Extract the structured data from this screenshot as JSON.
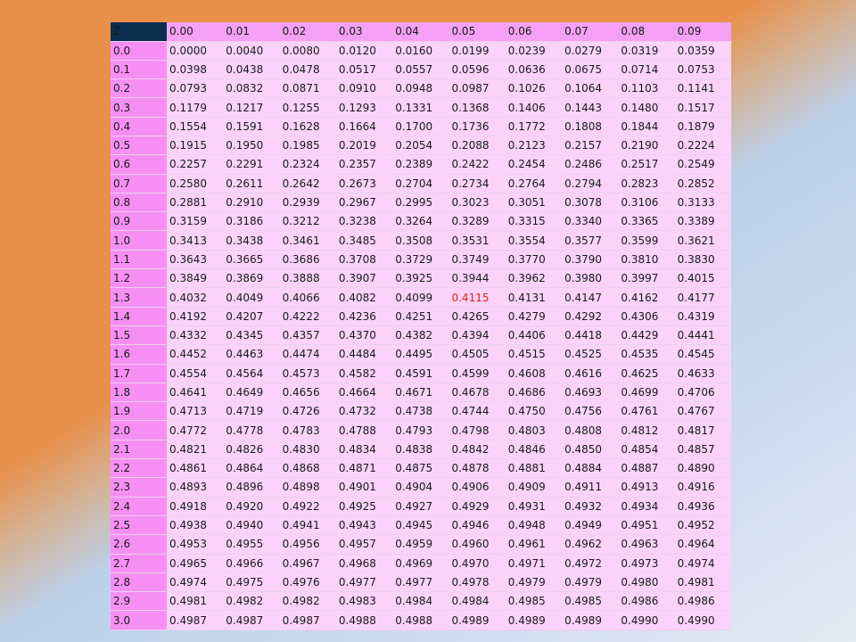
{
  "table": {
    "corner": "Z",
    "highlight_color": "#e8201a",
    "highlight": {
      "row": 13,
      "col": 5
    },
    "columns": [
      "0.00",
      "0.01",
      "0.02",
      "0.03",
      "0.04",
      "0.05",
      "0.06",
      "0.07",
      "0.08",
      "0.09"
    ],
    "rows": [
      {
        "z": "0.0",
        "values": [
          "0.0000",
          "0.0040",
          "0.0080",
          "0.0120",
          "0.0160",
          "0.0199",
          "0.0239",
          "0.0279",
          "0.0319",
          "0.0359"
        ]
      },
      {
        "z": "0.1",
        "values": [
          "0.0398",
          "0.0438",
          "0.0478",
          "0.0517",
          "0.0557",
          "0.0596",
          "0.0636",
          "0.0675",
          "0.0714",
          "0.0753"
        ]
      },
      {
        "z": "0.2",
        "values": [
          "0.0793",
          "0.0832",
          "0.0871",
          "0.0910",
          "0.0948",
          "0.0987",
          "0.1026",
          "0.1064",
          "0.1103",
          "0.1141"
        ]
      },
      {
        "z": "0.3",
        "values": [
          "0.1179",
          "0.1217",
          "0.1255",
          "0.1293",
          "0.1331",
          "0.1368",
          "0.1406",
          "0.1443",
          "0.1480",
          "0.1517"
        ]
      },
      {
        "z": "0.4",
        "values": [
          "0.1554",
          "0.1591",
          "0.1628",
          "0.1664",
          "0.1700",
          "0.1736",
          "0.1772",
          "0.1808",
          "0.1844",
          "0.1879"
        ]
      },
      {
        "z": "0.5",
        "values": [
          "0.1915",
          "0.1950",
          "0.1985",
          "0.2019",
          "0.2054",
          "0.2088",
          "0.2123",
          "0.2157",
          "0.2190",
          "0.2224"
        ]
      },
      {
        "z": "0.6",
        "values": [
          "0.2257",
          "0.2291",
          "0.2324",
          "0.2357",
          "0.2389",
          "0.2422",
          "0.2454",
          "0.2486",
          "0.2517",
          "0.2549"
        ]
      },
      {
        "z": "0.7",
        "values": [
          "0.2580",
          "0.2611",
          "0.2642",
          "0.2673",
          "0.2704",
          "0.2734",
          "0.2764",
          "0.2794",
          "0.2823",
          "0.2852"
        ]
      },
      {
        "z": "0.8",
        "values": [
          "0.2881",
          "0.2910",
          "0.2939",
          "0.2967",
          "0.2995",
          "0.3023",
          "0.3051",
          "0.3078",
          "0.3106",
          "0.3133"
        ]
      },
      {
        "z": "0.9",
        "values": [
          "0.3159",
          "0.3186",
          "0.3212",
          "0.3238",
          "0.3264",
          "0.3289",
          "0.3315",
          "0.3340",
          "0.3365",
          "0.3389"
        ]
      },
      {
        "z": "1.0",
        "values": [
          "0.3413",
          "0.3438",
          "0.3461",
          "0.3485",
          "0.3508",
          "0.3531",
          "0.3554",
          "0.3577",
          "0.3599",
          "0.3621"
        ]
      },
      {
        "z": "1.1",
        "values": [
          "0.3643",
          "0.3665",
          "0.3686",
          "0.3708",
          "0.3729",
          "0.3749",
          "0.3770",
          "0.3790",
          "0.3810",
          "0.3830"
        ]
      },
      {
        "z": "1.2",
        "values": [
          "0.3849",
          "0.3869",
          "0.3888",
          "0.3907",
          "0.3925",
          "0.3944",
          "0.3962",
          "0.3980",
          "0.3997",
          "0.4015"
        ]
      },
      {
        "z": "1.3",
        "values": [
          "0.4032",
          "0.4049",
          "0.4066",
          "0.4082",
          "0.4099",
          "0.4115",
          "0.4131",
          "0.4147",
          "0.4162",
          "0.4177"
        ]
      },
      {
        "z": "1.4",
        "values": [
          "0.4192",
          "0.4207",
          "0.4222",
          "0.4236",
          "0.4251",
          "0.4265",
          "0.4279",
          "0.4292",
          "0.4306",
          "0.4319"
        ]
      },
      {
        "z": "1.5",
        "values": [
          "0.4332",
          "0.4345",
          "0.4357",
          "0.4370",
          "0.4382",
          "0.4394",
          "0.4406",
          "0.4418",
          "0.4429",
          "0.4441"
        ]
      },
      {
        "z": "1.6",
        "values": [
          "0.4452",
          "0.4463",
          "0.4474",
          "0.4484",
          "0.4495",
          "0.4505",
          "0.4515",
          "0.4525",
          "0.4535",
          "0.4545"
        ]
      },
      {
        "z": "1.7",
        "values": [
          "0.4554",
          "0.4564",
          "0.4573",
          "0.4582",
          "0.4591",
          "0.4599",
          "0.4608",
          "0.4616",
          "0.4625",
          "0.4633"
        ]
      },
      {
        "z": "1.8",
        "values": [
          "0.4641",
          "0.4649",
          "0.4656",
          "0.4664",
          "0.4671",
          "0.4678",
          "0.4686",
          "0.4693",
          "0.4699",
          "0.4706"
        ]
      },
      {
        "z": "1.9",
        "values": [
          "0.4713",
          "0.4719",
          "0.4726",
          "0.4732",
          "0.4738",
          "0.4744",
          "0.4750",
          "0.4756",
          "0.4761",
          "0.4767"
        ]
      },
      {
        "z": "2.0",
        "values": [
          "0.4772",
          "0.4778",
          "0.4783",
          "0.4788",
          "0.4793",
          "0.4798",
          "0.4803",
          "0.4808",
          "0.4812",
          "0.4817"
        ]
      },
      {
        "z": "2.1",
        "values": [
          "0.4821",
          "0.4826",
          "0.4830",
          "0.4834",
          "0.4838",
          "0.4842",
          "0.4846",
          "0.4850",
          "0.4854",
          "0.4857"
        ]
      },
      {
        "z": "2.2",
        "values": [
          "0.4861",
          "0.4864",
          "0.4868",
          "0.4871",
          "0.4875",
          "0.4878",
          "0.4881",
          "0.4884",
          "0.4887",
          "0.4890"
        ]
      },
      {
        "z": "2.3",
        "values": [
          "0.4893",
          "0.4896",
          "0.4898",
          "0.4901",
          "0.4904",
          "0.4906",
          "0.4909",
          "0.4911",
          "0.4913",
          "0.4916"
        ]
      },
      {
        "z": "2.4",
        "values": [
          "0.4918",
          "0.4920",
          "0.4922",
          "0.4925",
          "0.4927",
          "0.4929",
          "0.4931",
          "0.4932",
          "0.4934",
          "0.4936"
        ]
      },
      {
        "z": "2.5",
        "values": [
          "0.4938",
          "0.4940",
          "0.4941",
          "0.4943",
          "0.4945",
          "0.4946",
          "0.4948",
          "0.4949",
          "0.4951",
          "0.4952"
        ]
      },
      {
        "z": "2.6",
        "values": [
          "0.4953",
          "0.4955",
          "0.4956",
          "0.4957",
          "0.4959",
          "0.4960",
          "0.4961",
          "0.4962",
          "0.4963",
          "0.4964"
        ]
      },
      {
        "z": "2.7",
        "values": [
          "0.4965",
          "0.4966",
          "0.4967",
          "0.4968",
          "0.4969",
          "0.4970",
          "0.4971",
          "0.4972",
          "0.4973",
          "0.4974"
        ]
      },
      {
        "z": "2.8",
        "values": [
          "0.4974",
          "0.4975",
          "0.4976",
          "0.4977",
          "0.4977",
          "0.4978",
          "0.4979",
          "0.4979",
          "0.4980",
          "0.4981"
        ]
      },
      {
        "z": "2.9",
        "values": [
          "0.4981",
          "0.4982",
          "0.4982",
          "0.4983",
          "0.4984",
          "0.4984",
          "0.4985",
          "0.4985",
          "0.4986",
          "0.4986"
        ]
      },
      {
        "z": "3.0",
        "values": [
          "0.4987",
          "0.4987",
          "0.4987",
          "0.4988",
          "0.4988",
          "0.4989",
          "0.4989",
          "0.4989",
          "0.4990",
          "0.4990"
        ]
      }
    ]
  }
}
